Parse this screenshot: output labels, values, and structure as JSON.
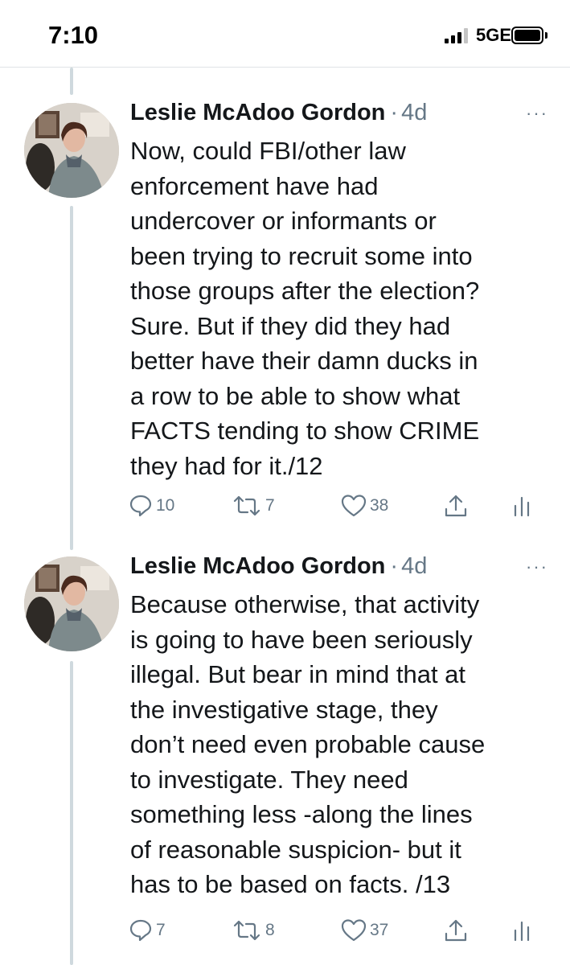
{
  "status": {
    "time": "7:10",
    "network": "5GE"
  },
  "tweets": [
    {
      "author": "Leslie McAdoo Gordon",
      "separator": "·",
      "time": "4d",
      "more": "···",
      "text": "Now, could FBI/other law\nenforcement have had\nundercover or informants or\nbeen trying to recruit some into\nthose groups after the election?\nSure. But if they did they had\nbetter have their damn ducks in\na row to be able to show what\nFACTS tending to show CRIME\nthey had for it./12",
      "replies": "10",
      "retweets": "7",
      "likes": "38"
    },
    {
      "author": "Leslie McAdoo Gordon",
      "separator": "·",
      "time": "4d",
      "more": "···",
      "text": "Because otherwise, that activity\nis going to have been seriously\nillegal. But bear in mind that at\nthe investigative stage, they\ndon’t need even probable cause\nto investigate. They need\nsomething less -along the lines\nof reasonable suspicion- but it\nhas to be based on facts. /13",
      "replies": "7",
      "retweets": "8",
      "likes": "37"
    }
  ],
  "icons": [
    "reply-icon",
    "retweet-icon",
    "like-icon",
    "share-icon",
    "analytics-icon",
    "more-icon"
  ]
}
